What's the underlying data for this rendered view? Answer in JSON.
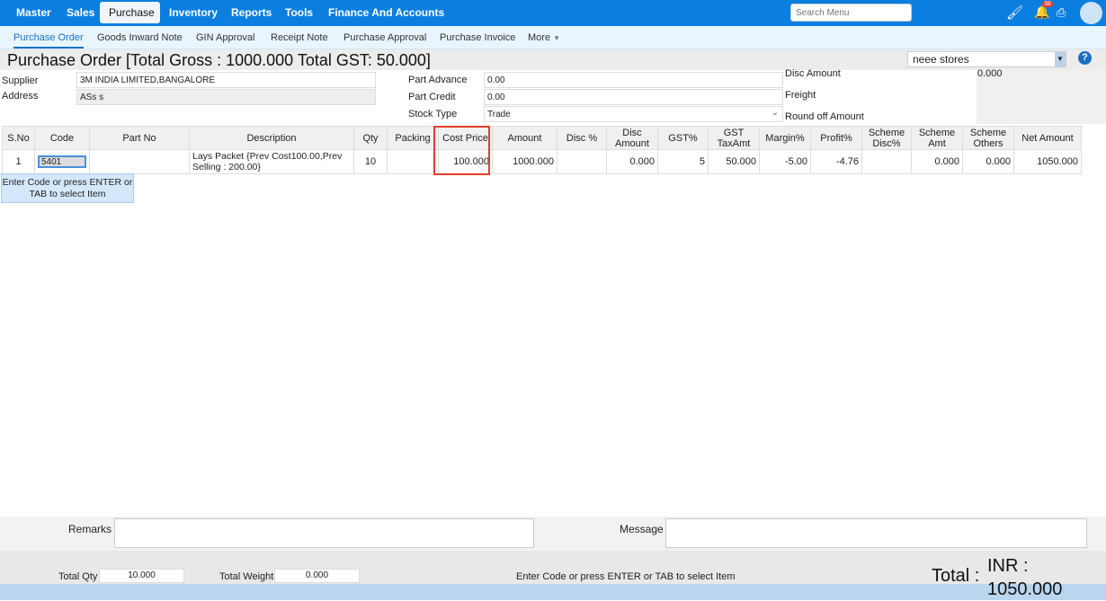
{
  "nav": {
    "items": [
      "Master",
      "Sales",
      "Purchase",
      "Inventory",
      "Reports",
      "Tools",
      "Finance And Accounts"
    ],
    "active": "Purchase",
    "search_placeholder": "Search Menu",
    "notifications": "38"
  },
  "subnav": {
    "items": [
      "Purchase Order",
      "Goods Inward Note",
      "GIN Approval",
      "Receipt Note",
      "Purchase Approval",
      "Purchase Invoice",
      "More"
    ]
  },
  "header": {
    "title": "Purchase Order [Total Gross : 1000.000 Total GST: 50.000]",
    "store": "neee stores",
    "help": "?"
  },
  "form": {
    "supplier_label": "Supplier",
    "supplier": "3M INDIA LIMITED,BANGALORE",
    "address_label": "Address",
    "address": "ASs s",
    "part_advance_label": "Part Advance",
    "part_advance": "0.00",
    "part_credit_label": "Part Credit",
    "part_credit": "0.00",
    "stock_type_label": "Stock Type",
    "stock_type": "Trade",
    "disc_amount_label": "Disc Amount",
    "disc_amount": "0.000",
    "freight_label": "Freight",
    "round_off_label": "Round off Amount"
  },
  "table": {
    "headers": [
      "S.No",
      "Code",
      "Part No",
      "Description",
      "Qty",
      "Packing",
      "Cost Price",
      "Amount",
      "Disc %",
      "Disc Amount",
      "GST%",
      "GST TaxAmt",
      "Margin%",
      "Profit%",
      "Scheme Disc%",
      "Scheme Amt",
      "Scheme Others",
      "Net Amount"
    ],
    "rows": [
      [
        "1",
        "5401",
        "",
        "Lays Packet {Prev Cost100.00,Prev Selling : 200.00}",
        "10",
        "",
        "100.000",
        "1000.000",
        "",
        "0.000",
        "5",
        "50.000",
        "-5.00",
        "-4.76",
        "",
        "0.000",
        "0.000",
        "1050.000"
      ]
    ]
  },
  "tooltip": "Enter Code or press ENTER or TAB to select Item",
  "footer": {
    "remarks_label": "Remarks",
    "message_label": "Message",
    "total_qty_label": "Total Qty",
    "total_qty": "10.000",
    "total_weight_label": "Total Weight",
    "total_weight": "0.000",
    "status": "Enter Code or press ENTER or TAB to select Item",
    "total_label": "Total :",
    "total_value": "INR : 1050.000"
  }
}
